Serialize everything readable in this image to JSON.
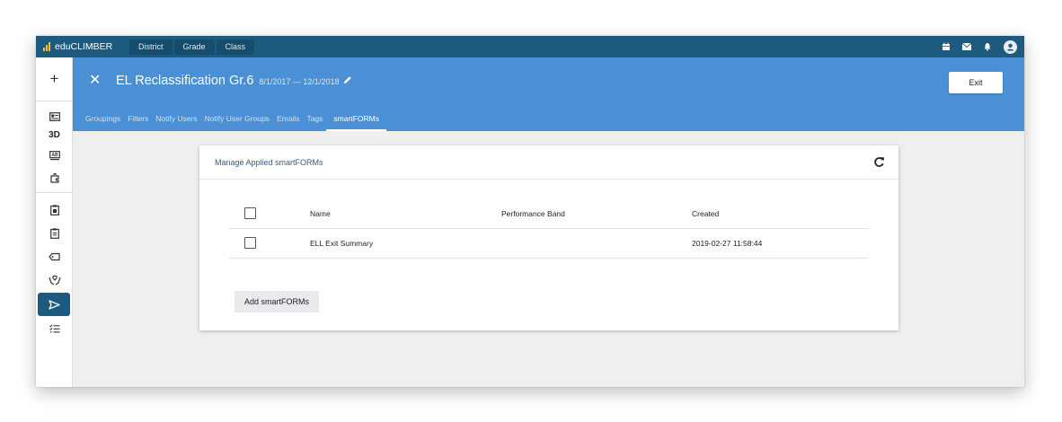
{
  "app": {
    "name": "eduCLIMBER",
    "top_nav": [
      "District",
      "Grade",
      "Class"
    ],
    "top_icons": [
      "calendar-icon",
      "mail-icon",
      "bell-icon",
      "user-avatar-icon"
    ]
  },
  "sidebar": {
    "add_label": "+",
    "items": [
      {
        "name": "id-card-icon"
      },
      {
        "name": "3d-view",
        "label": "3D"
      },
      {
        "name": "ab-icon"
      },
      {
        "name": "puzzle-icon"
      },
      {
        "name": "calendar-clipboard-icon"
      },
      {
        "name": "clipboard-icon"
      },
      {
        "name": "tag-icon"
      },
      {
        "name": "hands-heart-icon"
      },
      {
        "name": "send-icon",
        "active": true
      },
      {
        "name": "checklist-icon"
      }
    ]
  },
  "header": {
    "close_label": "✕",
    "title": "EL Reclassification Gr.6",
    "dates": "8/1/2017 — 12/1/2018",
    "exit_label": "Exit",
    "tabs": [
      {
        "label": "Groupings"
      },
      {
        "label": "Filters"
      },
      {
        "label": "Notify Users"
      },
      {
        "label": "Notify User Groups"
      },
      {
        "label": "Emails"
      },
      {
        "label": "Tags"
      },
      {
        "label": "smartFORMs",
        "active": true
      }
    ]
  },
  "card": {
    "title": "Manage Applied smartFORMs",
    "columns": [
      "Name",
      "Performance Band",
      "Created"
    ],
    "rows": [
      {
        "name": "ELL Exit Summary",
        "performance_band": "",
        "created": "2019-02-27 11:58:44"
      }
    ],
    "add_label": "Add smartFORMs"
  },
  "colors": {
    "topbar": "#1d5a7d",
    "header": "#4b8fd5",
    "logo_accent": "#f5c23b"
  }
}
